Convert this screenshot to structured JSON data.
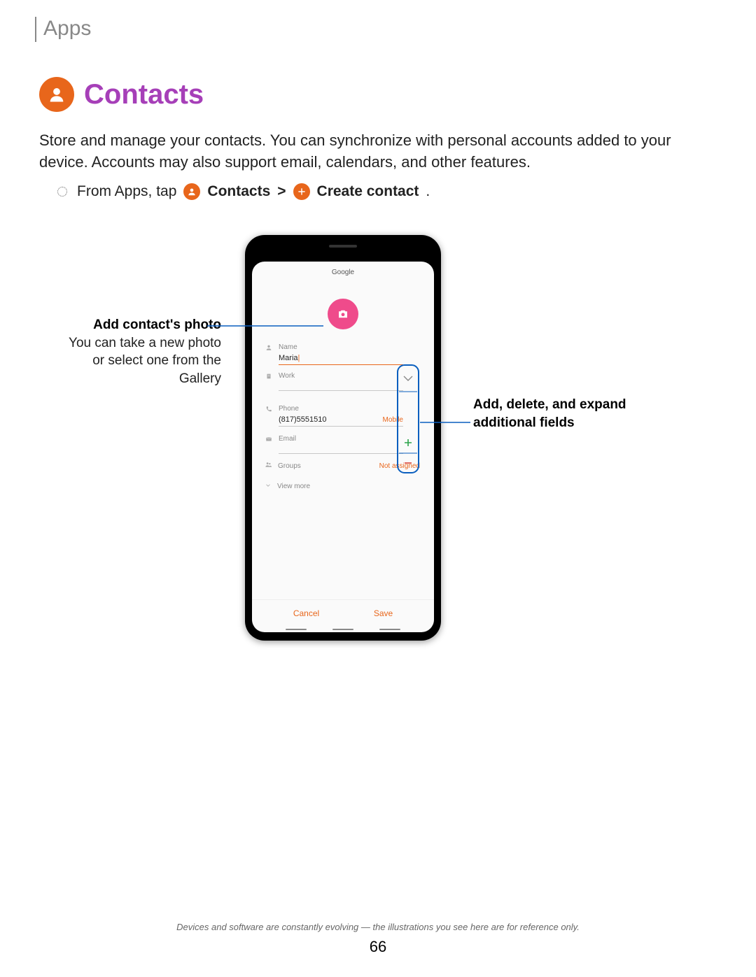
{
  "header": {
    "section": "Apps"
  },
  "title": "Contacts",
  "intro": "Store and manage your contacts. You can synchronize with personal accounts added to your device. Accounts may also support email, calendars, and other features.",
  "step": {
    "prefix": "From Apps, tap",
    "contacts": "Contacts",
    "chevron": ">",
    "create": "Create contact",
    "period": "."
  },
  "phone": {
    "account": "Google",
    "fields": {
      "name_label": "Name",
      "name_value": "Maria",
      "work_label": "Work",
      "phone_label": "Phone",
      "phone_value": "(817)5551510",
      "phone_type": "Mobile",
      "email_label": "Email",
      "groups_label": "Groups",
      "groups_value": "Not assigned",
      "viewmore": "View more"
    },
    "buttons": {
      "cancel": "Cancel",
      "save": "Save"
    }
  },
  "callouts": {
    "left_title": "Add contact's photo",
    "left_body": "You can take a new photo or select one from the Gallery",
    "right_title": "Add, delete, and expand additional fields"
  },
  "footer": "Devices and software are constantly evolving — the illustrations you see here are for reference only.",
  "page": "66"
}
